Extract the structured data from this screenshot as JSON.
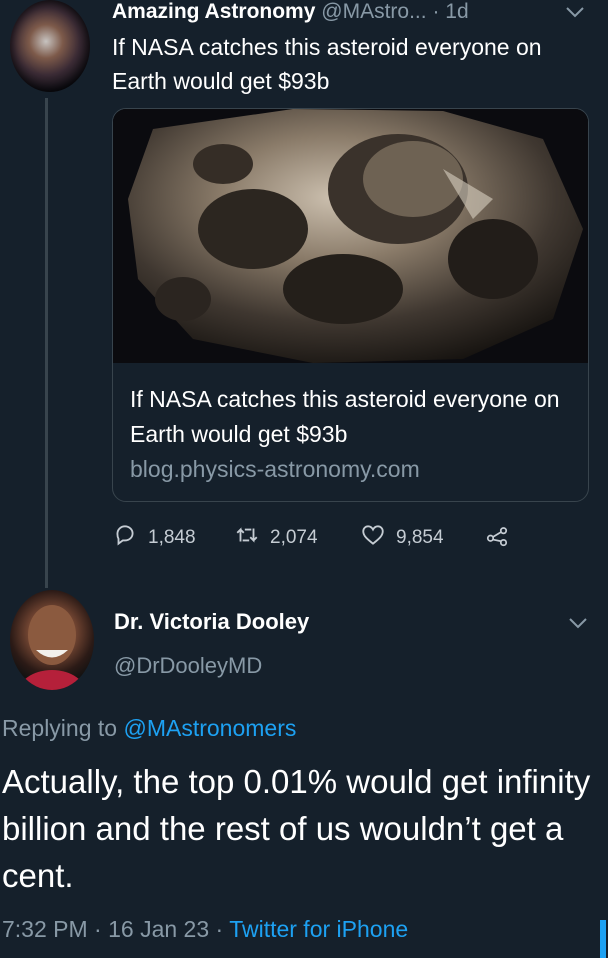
{
  "tweet1": {
    "author_name": "Amazing Astronomy",
    "handle": "@MAstro...",
    "separator": "·",
    "time": "1d",
    "text": "If NASA catches this asteroid everyone on Earth would get $93b",
    "card": {
      "title": "If NASA catches this asteroid everyone on Earth would get $93b",
      "domain": "blog.physics-astronomy.com"
    },
    "actions": {
      "replies": "1,848",
      "retweets": "2,074",
      "likes": "9,854"
    }
  },
  "tweet2": {
    "author_name": "Dr. Victoria Dooley",
    "handle": "@DrDooleyMD",
    "replying_prefix": "Replying to",
    "replying_to": "@MAstronomers",
    "text": "Actually, the top 0.01% would get infinity billion and the rest of us wouldn’t get a cent.",
    "time": "7:32 PM",
    "date": "16 Jan 23",
    "meta_separator": "·",
    "source": "Twitter for iPhone"
  },
  "icons": {
    "reply": "reply-icon",
    "retweet": "retweet-icon",
    "like": "heart-icon",
    "share": "share-icon",
    "more": "chevron-down-icon"
  },
  "colors": {
    "background": "#15202b",
    "secondary_text": "#8899a6",
    "accent": "#1da1f2",
    "border": "#38444d"
  }
}
